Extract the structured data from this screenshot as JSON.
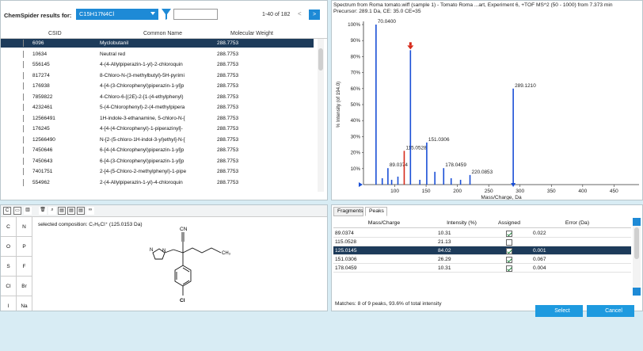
{
  "chemspider": {
    "title": "ChemSpider results for:",
    "formula": "C15H17N4Cl",
    "filter_value": "",
    "range": "1-40 of 182",
    "prev": "<",
    "next": ">",
    "columns": [
      "CSID",
      "Common Name",
      "Molecular Weight"
    ],
    "rows": [
      {
        "csid": "6096",
        "name": "Myclobutanil",
        "mw": "288.7753"
      },
      {
        "csid": "10634",
        "name": "Neutral red",
        "mw": "288.7753"
      },
      {
        "csid": "556145",
        "name": "4-(4-Allylpiperazin-1-yl)-2-chloroquin",
        "mw": "288.7753"
      },
      {
        "csid": "817274",
        "name": "8-Chloro-N-(3-methylbutyl)-5H-pyrimi",
        "mw": "288.7753"
      },
      {
        "csid": "176938",
        "name": "4-[4-(3-Chlorophenyl)piperazin-1-yl]p",
        "mw": "288.7753"
      },
      {
        "csid": "7859822",
        "name": "4-Chloro-6-[(2E)-2-[1-(4-ethylphenyl)",
        "mw": "288.7753"
      },
      {
        "csid": "4232461",
        "name": "5-(4-Chlorophenyl)-2-(4-methylpipera",
        "mw": "288.7753"
      },
      {
        "csid": "12566491",
        "name": "1H-indole-3-ethanamine, 5-chloro-N-[",
        "mw": "288.7753"
      },
      {
        "csid": "176245",
        "name": "4-[4-(4-Chlorophenyl)-1-piperazinyl]-",
        "mw": "288.7753"
      },
      {
        "csid": "12566490",
        "name": "N-[2-(5-chloro-1H-indol-3-yl)ethyl]-N-[",
        "mw": "288.7753"
      },
      {
        "csid": "7450646",
        "name": "6-[4-(4-Chlorophenyl)piperazin-1-yl]p",
        "mw": "288.7753"
      },
      {
        "csid": "7450643",
        "name": "6-[4-(3-Chlorophenyl)piperazin-1-yl]p",
        "mw": "288.7753"
      },
      {
        "csid": "7401751",
        "name": "2-[4-(5-Chloro-2-methylphenyl)-1-pipe",
        "mw": "288.7753"
      },
      {
        "csid": "554962",
        "name": "2-(4-Allylpiperazin-1-yl)-4-chloroquin",
        "mw": "288.7753"
      }
    ]
  },
  "spectrum": {
    "title": "Spectrum from Roma tomato.wiff (sample 1) - Tomato Roma ...art, Experiment 6, +TOF MS^2 (50 - 1000) from 7.373 min",
    "precursor": "Precursor: 289.1 Da, CE: 35.0 CE=35",
    "ylabel": "% Intensity (of 194.0)",
    "xlabel": "Mass/Charge, Da",
    "y_ticks": [
      "100%",
      "90%",
      "80%",
      "70%",
      "60%",
      "50%",
      "40%",
      "30%",
      "20%",
      "10%"
    ],
    "x_ticks": [
      "100",
      "150",
      "200",
      "250",
      "300",
      "350",
      "400",
      "450"
    ]
  },
  "chart_data": {
    "type": "bar",
    "ylabel": "% Intensity (of 194.0)",
    "xlabel": "Mass/Charge, Da",
    "xlim": [
      50,
      490
    ],
    "ylim": [
      0,
      100
    ],
    "peaks": [
      {
        "mz": 70.04,
        "intensity": 100,
        "label": "70.0400",
        "color": "#1a4fd6"
      },
      {
        "mz": 89.0374,
        "intensity": 10.3,
        "label": "89.0374",
        "color": "#1a4fd6"
      },
      {
        "mz": 115.0528,
        "intensity": 21.1,
        "label": "115.0528",
        "color": "#d62a1a"
      },
      {
        "mz": 125.0145,
        "intensity": 84.0,
        "label": "",
        "color": "#1a4fd6"
      },
      {
        "mz": 151.0306,
        "intensity": 26.3,
        "label": "151.0306",
        "color": "#1a4fd6"
      },
      {
        "mz": 178.0459,
        "intensity": 10.3,
        "label": "178.0459",
        "color": "#1a4fd6"
      },
      {
        "mz": 220.0853,
        "intensity": 6.0,
        "label": "220.0853",
        "color": "#1a4fd6"
      },
      {
        "mz": 289.121,
        "intensity": 60.0,
        "label": "289.1210",
        "color": "#1a4fd6"
      },
      {
        "mz": 80,
        "intensity": 4,
        "label": "",
        "color": "#1a4fd6"
      },
      {
        "mz": 95,
        "intensity": 3,
        "label": "",
        "color": "#1a4fd6"
      },
      {
        "mz": 105,
        "intensity": 5,
        "label": "",
        "color": "#1a4fd6"
      },
      {
        "mz": 140,
        "intensity": 3,
        "label": "",
        "color": "#1a4fd6"
      },
      {
        "mz": 164,
        "intensity": 8,
        "label": "",
        "color": "#1a4fd6"
      },
      {
        "mz": 190,
        "intensity": 4,
        "label": "",
        "color": "#1a4fd6"
      },
      {
        "mz": 205,
        "intensity": 3,
        "label": "",
        "color": "#1a4fd6"
      }
    ]
  },
  "structure": {
    "composition": "selected composition: C₇H₆Cl⁺ (125.0153 Da)",
    "elements": [
      "C",
      "N",
      "O",
      "P",
      "S",
      "F",
      "Cl",
      "Br",
      "I",
      "Na"
    ],
    "labels": {
      "cn": "CN",
      "ch3": "CH₃",
      "n": "N",
      "cl": "Cl"
    }
  },
  "peaks": {
    "tabs": [
      "Fragments",
      "Peaks"
    ],
    "columns": [
      "Mass/Charge",
      "Intensity (%)",
      "Assigned",
      "Error (Da)"
    ],
    "rows": [
      {
        "mz": "89.0374",
        "intensity": "10.31",
        "assigned": true,
        "error": "0.022"
      },
      {
        "mz": "115.0528",
        "intensity": "21.13",
        "assigned": false,
        "error": ""
      },
      {
        "mz": "125.0145",
        "intensity": "84.02",
        "assigned": true,
        "error": "0.001"
      },
      {
        "mz": "151.0306",
        "intensity": "26.29",
        "assigned": true,
        "error": "0.067"
      },
      {
        "mz": "178.0459",
        "intensity": "10.31",
        "assigned": true,
        "error": "0.004"
      }
    ],
    "footer": "Matches: 8 of 9 peaks, 93.6% of total intensity"
  },
  "buttons": {
    "select": "Select",
    "cancel": "Cancel"
  }
}
